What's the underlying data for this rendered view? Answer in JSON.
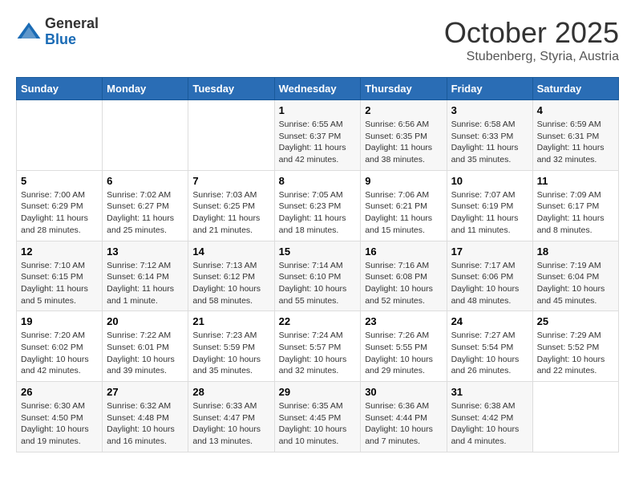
{
  "logo": {
    "general": "General",
    "blue": "Blue"
  },
  "header": {
    "month": "October 2025",
    "location": "Stubenberg, Styria, Austria"
  },
  "weekdays": [
    "Sunday",
    "Monday",
    "Tuesday",
    "Wednesday",
    "Thursday",
    "Friday",
    "Saturday"
  ],
  "weeks": [
    [
      {
        "day": "",
        "sunrise": "",
        "sunset": "",
        "daylight": ""
      },
      {
        "day": "",
        "sunrise": "",
        "sunset": "",
        "daylight": ""
      },
      {
        "day": "",
        "sunrise": "",
        "sunset": "",
        "daylight": ""
      },
      {
        "day": "1",
        "sunrise": "Sunrise: 6:55 AM",
        "sunset": "Sunset: 6:37 PM",
        "daylight": "Daylight: 11 hours and 42 minutes."
      },
      {
        "day": "2",
        "sunrise": "Sunrise: 6:56 AM",
        "sunset": "Sunset: 6:35 PM",
        "daylight": "Daylight: 11 hours and 38 minutes."
      },
      {
        "day": "3",
        "sunrise": "Sunrise: 6:58 AM",
        "sunset": "Sunset: 6:33 PM",
        "daylight": "Daylight: 11 hours and 35 minutes."
      },
      {
        "day": "4",
        "sunrise": "Sunrise: 6:59 AM",
        "sunset": "Sunset: 6:31 PM",
        "daylight": "Daylight: 11 hours and 32 minutes."
      }
    ],
    [
      {
        "day": "5",
        "sunrise": "Sunrise: 7:00 AM",
        "sunset": "Sunset: 6:29 PM",
        "daylight": "Daylight: 11 hours and 28 minutes."
      },
      {
        "day": "6",
        "sunrise": "Sunrise: 7:02 AM",
        "sunset": "Sunset: 6:27 PM",
        "daylight": "Daylight: 11 hours and 25 minutes."
      },
      {
        "day": "7",
        "sunrise": "Sunrise: 7:03 AM",
        "sunset": "Sunset: 6:25 PM",
        "daylight": "Daylight: 11 hours and 21 minutes."
      },
      {
        "day": "8",
        "sunrise": "Sunrise: 7:05 AM",
        "sunset": "Sunset: 6:23 PM",
        "daylight": "Daylight: 11 hours and 18 minutes."
      },
      {
        "day": "9",
        "sunrise": "Sunrise: 7:06 AM",
        "sunset": "Sunset: 6:21 PM",
        "daylight": "Daylight: 11 hours and 15 minutes."
      },
      {
        "day": "10",
        "sunrise": "Sunrise: 7:07 AM",
        "sunset": "Sunset: 6:19 PM",
        "daylight": "Daylight: 11 hours and 11 minutes."
      },
      {
        "day": "11",
        "sunrise": "Sunrise: 7:09 AM",
        "sunset": "Sunset: 6:17 PM",
        "daylight": "Daylight: 11 hours and 8 minutes."
      }
    ],
    [
      {
        "day": "12",
        "sunrise": "Sunrise: 7:10 AM",
        "sunset": "Sunset: 6:15 PM",
        "daylight": "Daylight: 11 hours and 5 minutes."
      },
      {
        "day": "13",
        "sunrise": "Sunrise: 7:12 AM",
        "sunset": "Sunset: 6:14 PM",
        "daylight": "Daylight: 11 hours and 1 minute."
      },
      {
        "day": "14",
        "sunrise": "Sunrise: 7:13 AM",
        "sunset": "Sunset: 6:12 PM",
        "daylight": "Daylight: 10 hours and 58 minutes."
      },
      {
        "day": "15",
        "sunrise": "Sunrise: 7:14 AM",
        "sunset": "Sunset: 6:10 PM",
        "daylight": "Daylight: 10 hours and 55 minutes."
      },
      {
        "day": "16",
        "sunrise": "Sunrise: 7:16 AM",
        "sunset": "Sunset: 6:08 PM",
        "daylight": "Daylight: 10 hours and 52 minutes."
      },
      {
        "day": "17",
        "sunrise": "Sunrise: 7:17 AM",
        "sunset": "Sunset: 6:06 PM",
        "daylight": "Daylight: 10 hours and 48 minutes."
      },
      {
        "day": "18",
        "sunrise": "Sunrise: 7:19 AM",
        "sunset": "Sunset: 6:04 PM",
        "daylight": "Daylight: 10 hours and 45 minutes."
      }
    ],
    [
      {
        "day": "19",
        "sunrise": "Sunrise: 7:20 AM",
        "sunset": "Sunset: 6:02 PM",
        "daylight": "Daylight: 10 hours and 42 minutes."
      },
      {
        "day": "20",
        "sunrise": "Sunrise: 7:22 AM",
        "sunset": "Sunset: 6:01 PM",
        "daylight": "Daylight: 10 hours and 39 minutes."
      },
      {
        "day": "21",
        "sunrise": "Sunrise: 7:23 AM",
        "sunset": "Sunset: 5:59 PM",
        "daylight": "Daylight: 10 hours and 35 minutes."
      },
      {
        "day": "22",
        "sunrise": "Sunrise: 7:24 AM",
        "sunset": "Sunset: 5:57 PM",
        "daylight": "Daylight: 10 hours and 32 minutes."
      },
      {
        "day": "23",
        "sunrise": "Sunrise: 7:26 AM",
        "sunset": "Sunset: 5:55 PM",
        "daylight": "Daylight: 10 hours and 29 minutes."
      },
      {
        "day": "24",
        "sunrise": "Sunrise: 7:27 AM",
        "sunset": "Sunset: 5:54 PM",
        "daylight": "Daylight: 10 hours and 26 minutes."
      },
      {
        "day": "25",
        "sunrise": "Sunrise: 7:29 AM",
        "sunset": "Sunset: 5:52 PM",
        "daylight": "Daylight: 10 hours and 22 minutes."
      }
    ],
    [
      {
        "day": "26",
        "sunrise": "Sunrise: 6:30 AM",
        "sunset": "Sunset: 4:50 PM",
        "daylight": "Daylight: 10 hours and 19 minutes."
      },
      {
        "day": "27",
        "sunrise": "Sunrise: 6:32 AM",
        "sunset": "Sunset: 4:48 PM",
        "daylight": "Daylight: 10 hours and 16 minutes."
      },
      {
        "day": "28",
        "sunrise": "Sunrise: 6:33 AM",
        "sunset": "Sunset: 4:47 PM",
        "daylight": "Daylight: 10 hours and 13 minutes."
      },
      {
        "day": "29",
        "sunrise": "Sunrise: 6:35 AM",
        "sunset": "Sunset: 4:45 PM",
        "daylight": "Daylight: 10 hours and 10 minutes."
      },
      {
        "day": "30",
        "sunrise": "Sunrise: 6:36 AM",
        "sunset": "Sunset: 4:44 PM",
        "daylight": "Daylight: 10 hours and 7 minutes."
      },
      {
        "day": "31",
        "sunrise": "Sunrise: 6:38 AM",
        "sunset": "Sunset: 4:42 PM",
        "daylight": "Daylight: 10 hours and 4 minutes."
      },
      {
        "day": "",
        "sunrise": "",
        "sunset": "",
        "daylight": ""
      }
    ]
  ]
}
